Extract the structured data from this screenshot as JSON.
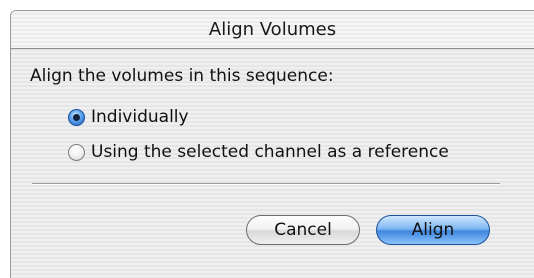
{
  "dialog": {
    "title": "Align Volumes",
    "prompt": "Align the volumes in this sequence:",
    "options": [
      {
        "label": "Individually",
        "selected": true
      },
      {
        "label": "Using the selected channel as a reference",
        "selected": false
      }
    ],
    "buttons": {
      "cancel_label": "Cancel",
      "align_label": "Align"
    }
  },
  "colors": {
    "accent": "#3f86dc",
    "window_bg": "#eeeeee"
  }
}
